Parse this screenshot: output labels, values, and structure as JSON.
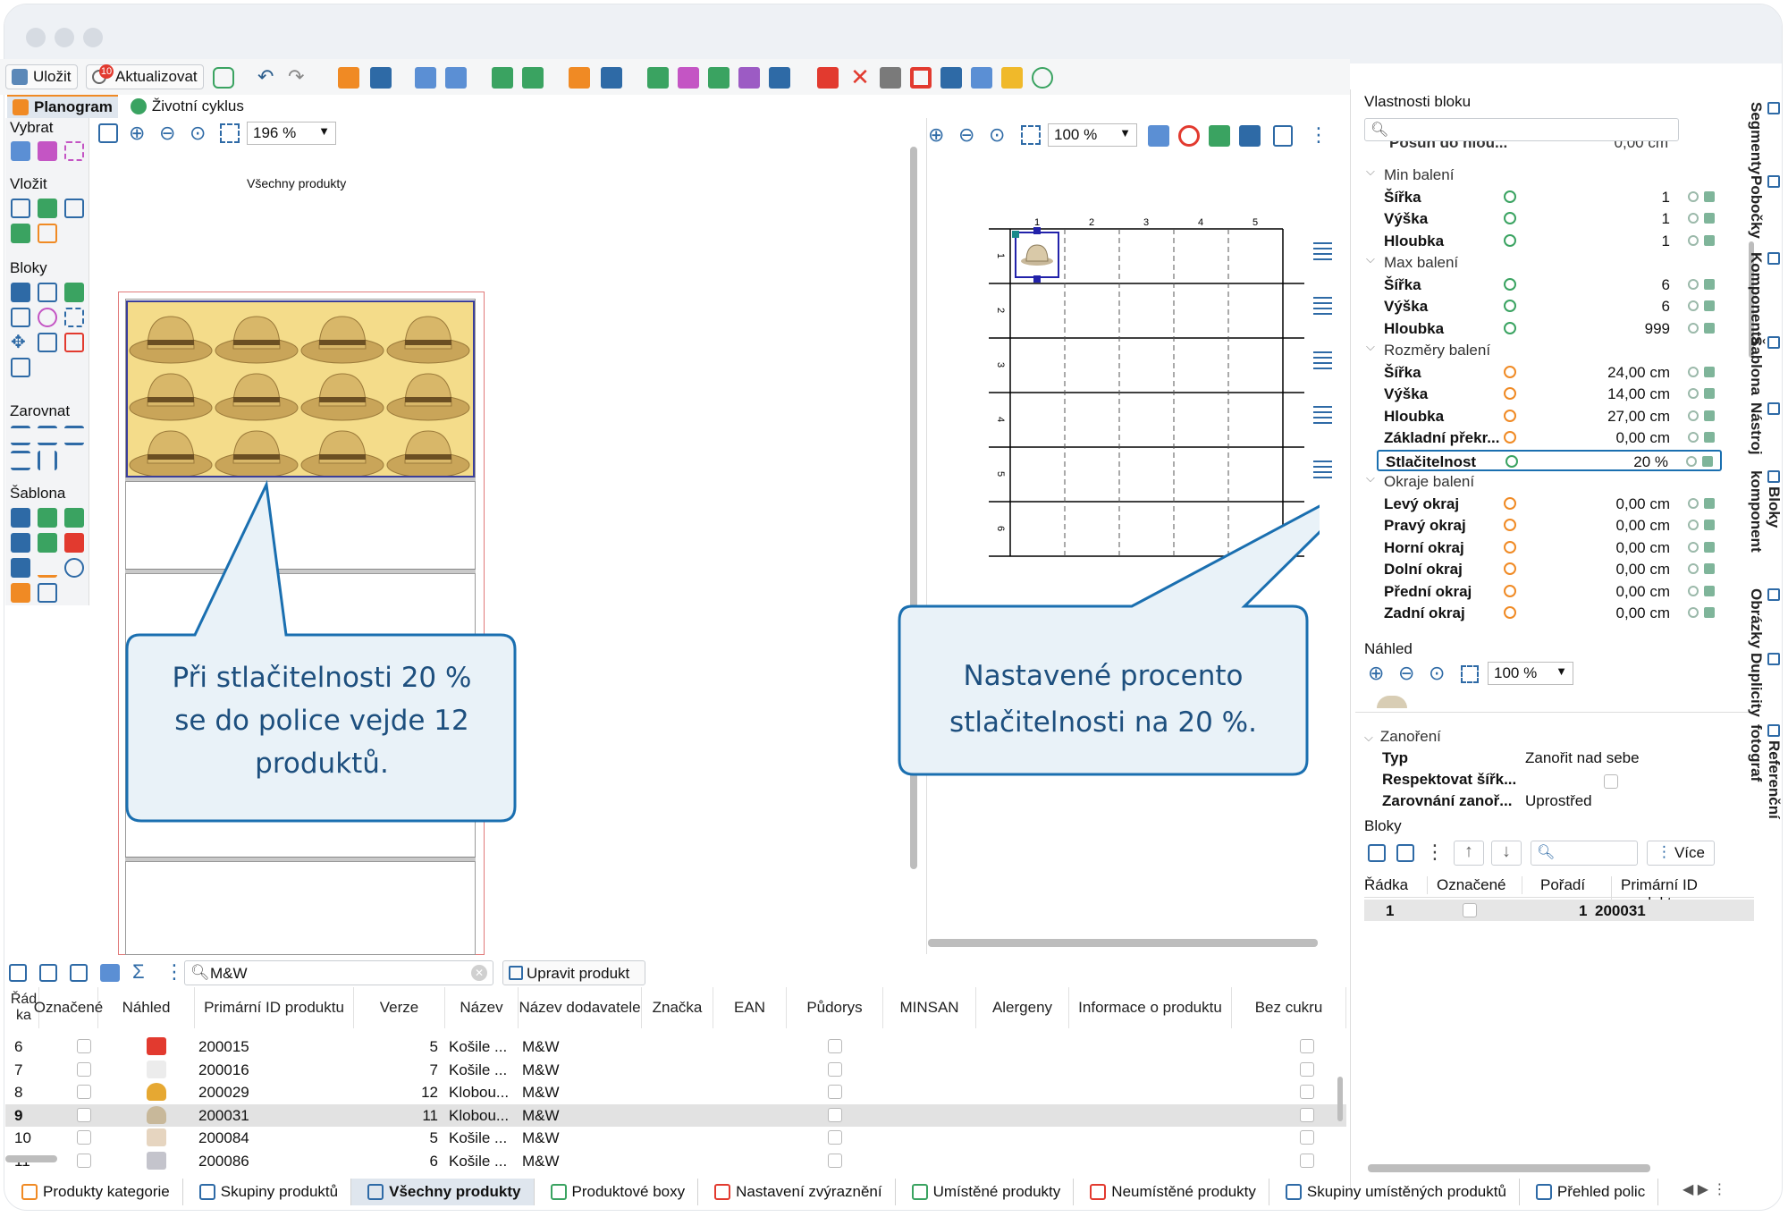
{
  "toolbar": {
    "save_label": "Uložit",
    "update_label": "Aktualizovat",
    "update_badge": "10"
  },
  "tabs": [
    {
      "label": "Planogram",
      "active": true
    },
    {
      "label": "Životní cyklus",
      "active": false
    }
  ],
  "left_panel": {
    "sections": [
      "Vybrat",
      "Vložit",
      "Bloky",
      "Zarovnat",
      "Šablona"
    ]
  },
  "left_canvas": {
    "zoom": "196 %",
    "title": "Všechny produkty",
    "callout": [
      "Při stlačitelnosti 20 %",
      "se do police vejde 12",
      "produktů."
    ],
    "hat_count": 12
  },
  "mid_canvas": {
    "zoom": "100 %",
    "col_labels": [
      "1",
      "2",
      "3",
      "4",
      "5"
    ],
    "row_labels": [
      "1",
      "2",
      "3",
      "4",
      "5",
      "6"
    ],
    "callout": [
      "Nastavené procento",
      "stlačitelnosti na 20 %."
    ]
  },
  "properties": {
    "title": "Vlastnosti bloku",
    "truncated_row": {
      "label": "Posun do hlou...",
      "value": "0,00 cm"
    },
    "groups": [
      {
        "name": "Min balení",
        "rows": [
          {
            "label": "Šířka",
            "value": "1",
            "icon": "green"
          },
          {
            "label": "Výška",
            "value": "1",
            "icon": "green"
          },
          {
            "label": "Hloubka",
            "value": "1",
            "icon": "green"
          }
        ]
      },
      {
        "name": "Max balení",
        "rows": [
          {
            "label": "Šířka",
            "value": "6",
            "icon": "green"
          },
          {
            "label": "Výška",
            "value": "6",
            "icon": "green"
          },
          {
            "label": "Hloubka",
            "value": "999",
            "icon": "green"
          }
        ]
      },
      {
        "name": "Rozměry balení",
        "rows": [
          {
            "label": "Šířka",
            "value": "24,00 cm",
            "icon": "orange"
          },
          {
            "label": "Výška",
            "value": "14,00 cm",
            "icon": "orange"
          },
          {
            "label": "Hloubka",
            "value": "27,00 cm",
            "icon": "orange"
          },
          {
            "label": "Základní překr...",
            "value": "0,00 cm",
            "icon": "orange"
          },
          {
            "label": "Stlačitelnost",
            "value": "20 %",
            "icon": "green",
            "highlight": true
          }
        ]
      },
      {
        "name": "Okraje balení",
        "rows": [
          {
            "label": "Levý okraj",
            "value": "0,00 cm",
            "icon": "orange"
          },
          {
            "label": "Pravý okraj",
            "value": "0,00 cm",
            "icon": "orange"
          },
          {
            "label": "Horní okraj",
            "value": "0,00 cm",
            "icon": "orange"
          },
          {
            "label": "Dolní okraj",
            "value": "0,00 cm",
            "icon": "orange"
          },
          {
            "label": "Přední okraj",
            "value": "0,00 cm",
            "icon": "orange"
          },
          {
            "label": "Zadní okraj",
            "value": "0,00 cm",
            "icon": "orange"
          }
        ]
      }
    ],
    "preview": {
      "title": "Náhled",
      "zoom": "100 %"
    },
    "nesting": {
      "title": "Zanoření",
      "rows": [
        {
          "label": "Typ",
          "value": "Zanořit nad sebe"
        },
        {
          "label": "Respektovat šířk...",
          "value": ""
        },
        {
          "label": "Zarovnání zanoř...",
          "value": "Uprostřed"
        }
      ]
    },
    "blocks": {
      "title": "Bloky",
      "more_label": "Více",
      "headers": [
        "Řádka",
        "Označené",
        "Pořadí",
        "Primární ID produktu"
      ],
      "rows": [
        {
          "row": "1",
          "order": "1",
          "id": "200031"
        }
      ]
    }
  },
  "right_tabs": [
    "Segmenty",
    "Pobočky",
    "Komponenta",
    "Šablona",
    "Nástroj",
    "Bloky komponent",
    "Obrázky",
    "Duplicity",
    "Referenční fotograf"
  ],
  "product_table": {
    "search_value": "M&W",
    "edit_label": "Upravit produkt",
    "headers": [
      "Řád ka",
      "Označené",
      "Náhled",
      "Primární ID produktu",
      "Verze",
      "Název",
      "Název dodavatele",
      "Značka",
      "EAN",
      "Půdorys",
      "MINSAN",
      "Alergeny",
      "Informace o produktu",
      "Bez cukru"
    ],
    "rows": [
      {
        "row": "6",
        "id": "200015",
        "version": "5",
        "name": "Košile ...",
        "supplier": "M&W",
        "thumb": "red-shirt"
      },
      {
        "row": "7",
        "id": "200016",
        "version": "7",
        "name": "Košile ...",
        "supplier": "M&W",
        "thumb": "white-shirt"
      },
      {
        "row": "8",
        "id": "200029",
        "version": "12",
        "name": "Klobou...",
        "supplier": "M&W",
        "thumb": "yellow-hat"
      },
      {
        "row": "9",
        "id": "200031",
        "version": "11",
        "name": "Klobou...",
        "supplier": "M&W",
        "thumb": "beige-hat",
        "selected": true
      },
      {
        "row": "10",
        "id": "200084",
        "version": "5",
        "name": "Košile ...",
        "supplier": "M&W",
        "thumb": "beige-shirt"
      },
      {
        "row": "11",
        "id": "200086",
        "version": "6",
        "name": "Košile ...",
        "supplier": "M&W",
        "thumb": "grey-shirt"
      }
    ]
  },
  "bottom_tabs": [
    {
      "label": "Produkty kategorie",
      "active": false
    },
    {
      "label": "Skupiny produktů",
      "active": false
    },
    {
      "label": "Všechny produkty",
      "active": true
    },
    {
      "label": "Produktové boxy",
      "active": false
    },
    {
      "label": "Nastavení zvýraznění",
      "active": false
    },
    {
      "label": "Umístěné produkty",
      "active": false
    },
    {
      "label": "Neumístěné produkty",
      "active": false
    },
    {
      "label": "Skupiny umístěných produktů",
      "active": false
    },
    {
      "label": "Přehled polic",
      "active": false
    }
  ],
  "colors": {
    "accent": "#1a6fb0",
    "callout_border": "#1a6fb0",
    "callout_fill": "#e9f2f8",
    "callout_text": "#1d4f7e",
    "hat_bg": "#f4dc8a",
    "orange": "#f08a24",
    "green": "#3aa361"
  }
}
